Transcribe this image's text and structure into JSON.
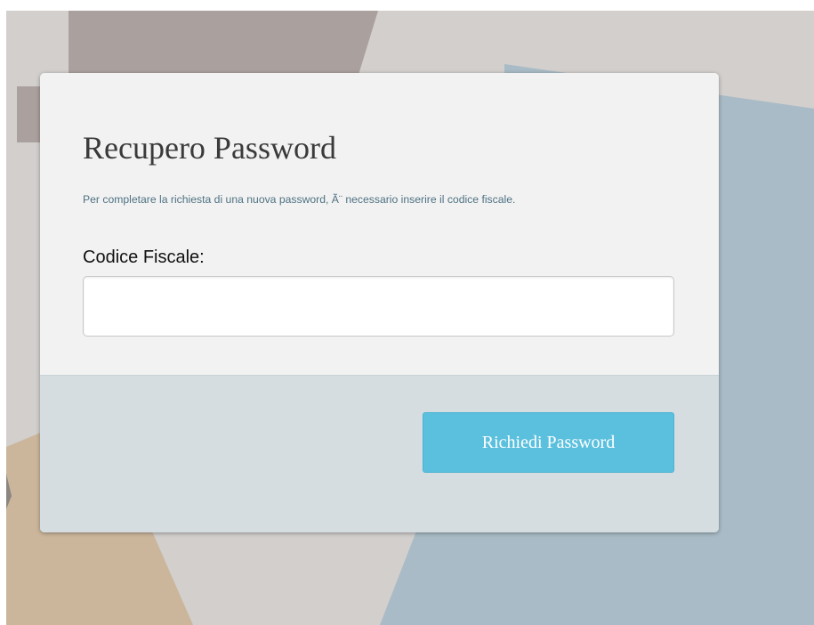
{
  "card": {
    "title": "Recupero Password",
    "description": "Per completare la richiesta di una nuova password, Ã¨ necessario inserire il codice fiscale.",
    "field_label": "Codice Fiscale:",
    "field_value": "",
    "field_placeholder": "",
    "submit_label": "Richiedi Password"
  },
  "colors": {
    "card_top": "#f2f2f2",
    "card_bottom": "#d5dde1",
    "button": "#5bc0de",
    "description_text": "#4e7282",
    "background": "#d2cfcd"
  }
}
